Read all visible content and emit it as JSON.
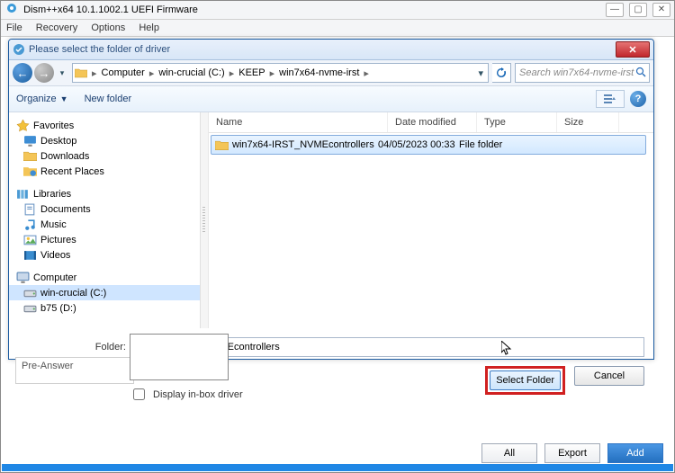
{
  "app_title": "Dism++x64 10.1.1002.1 UEFI Firmware",
  "menu": {
    "file": "File",
    "recovery": "Recovery",
    "options": "Options",
    "help": "Help"
  },
  "dialog": {
    "title": "Please select the folder of driver",
    "breadcrumb": {
      "root": "Computer",
      "drive": "win-crucial (C:)",
      "folder1": "KEEP",
      "folder2": "win7x64-nvme-irst"
    },
    "search_placeholder": "Search win7x64-nvme-irst",
    "organize": "Organize",
    "newfolder": "New folder",
    "columns": {
      "name": "Name",
      "date": "Date modified",
      "type": "Type",
      "size": "Size"
    },
    "tree": {
      "favorites": "Favorites",
      "desktop": "Desktop",
      "downloads": "Downloads",
      "recent": "Recent Places",
      "libraries": "Libraries",
      "documents": "Documents",
      "music": "Music",
      "pictures": "Pictures",
      "videos": "Videos",
      "computer": "Computer",
      "drive_c": "win-crucial (C:)",
      "drive_d": "b75 (D:)"
    },
    "row": {
      "name": "win7x64-IRST_NVMEcontrollers",
      "date": "04/05/2023 00:33",
      "type": "File folder",
      "size": ""
    },
    "folder_label": "Folder:",
    "folder_value": "win7x64-IRST_NVMEcontrollers",
    "select_btn": "Select Folder",
    "cancel_btn": "Cancel"
  },
  "bg": {
    "pre_answer": "Pre-Answer",
    "inbox_label": "Display in-box driver"
  },
  "bottom": {
    "all": "All",
    "export": "Export",
    "add": "Add"
  }
}
